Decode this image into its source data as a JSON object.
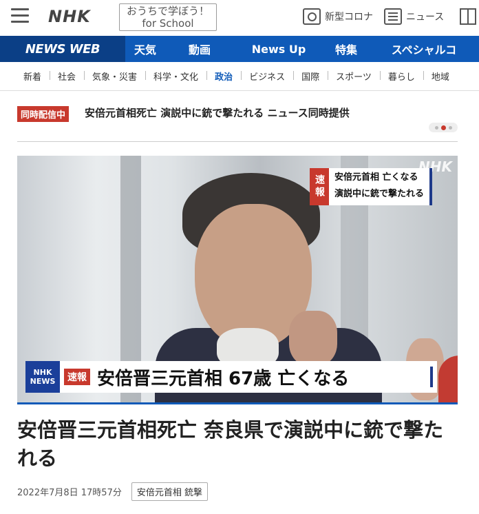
{
  "header": {
    "logo": "NHK",
    "school_line1": "おうちで学ぼう！",
    "school_line2": "for School",
    "corona_label": "新型コロナ",
    "news_label": "ニュース"
  },
  "bluenav": {
    "brand": "NEWS WEB",
    "items": [
      "天気",
      "動画",
      "News Up",
      "特集",
      "スペシャルコ"
    ]
  },
  "subnav": {
    "items": [
      "新着",
      "社会",
      "気象・災害",
      "科学・文化",
      "政治",
      "ビジネス",
      "国際",
      "スポーツ",
      "暮らし",
      "地域"
    ],
    "active": "政治"
  },
  "ticker": {
    "badge": "同時配信中",
    "text": "安倍元首相死亡 演説中に銃で撃たれる ニュース同時提供"
  },
  "hero": {
    "watermark": "NHK",
    "flash_badge": "速報",
    "flash_line1": "安倍元首相 亡くなる",
    "flash_line2": "演説中に銃で撃たれる",
    "lt_logo1": "NHK",
    "lt_logo2": "NEWS",
    "lt_badge": "速報",
    "lt_text": "安倍晋三元首相 67歳 亡くなる"
  },
  "article": {
    "headline": "安倍晋三元首相死亡 奈良県で演説中に銃で撃たれる",
    "date": "2022年7月8日 17時57分",
    "tag": "安倍元首相 銃撃"
  },
  "colors": {
    "brand_blue": "#0f5ab8",
    "dark_blue": "#0b3f86",
    "alert_red": "#c8392d"
  }
}
